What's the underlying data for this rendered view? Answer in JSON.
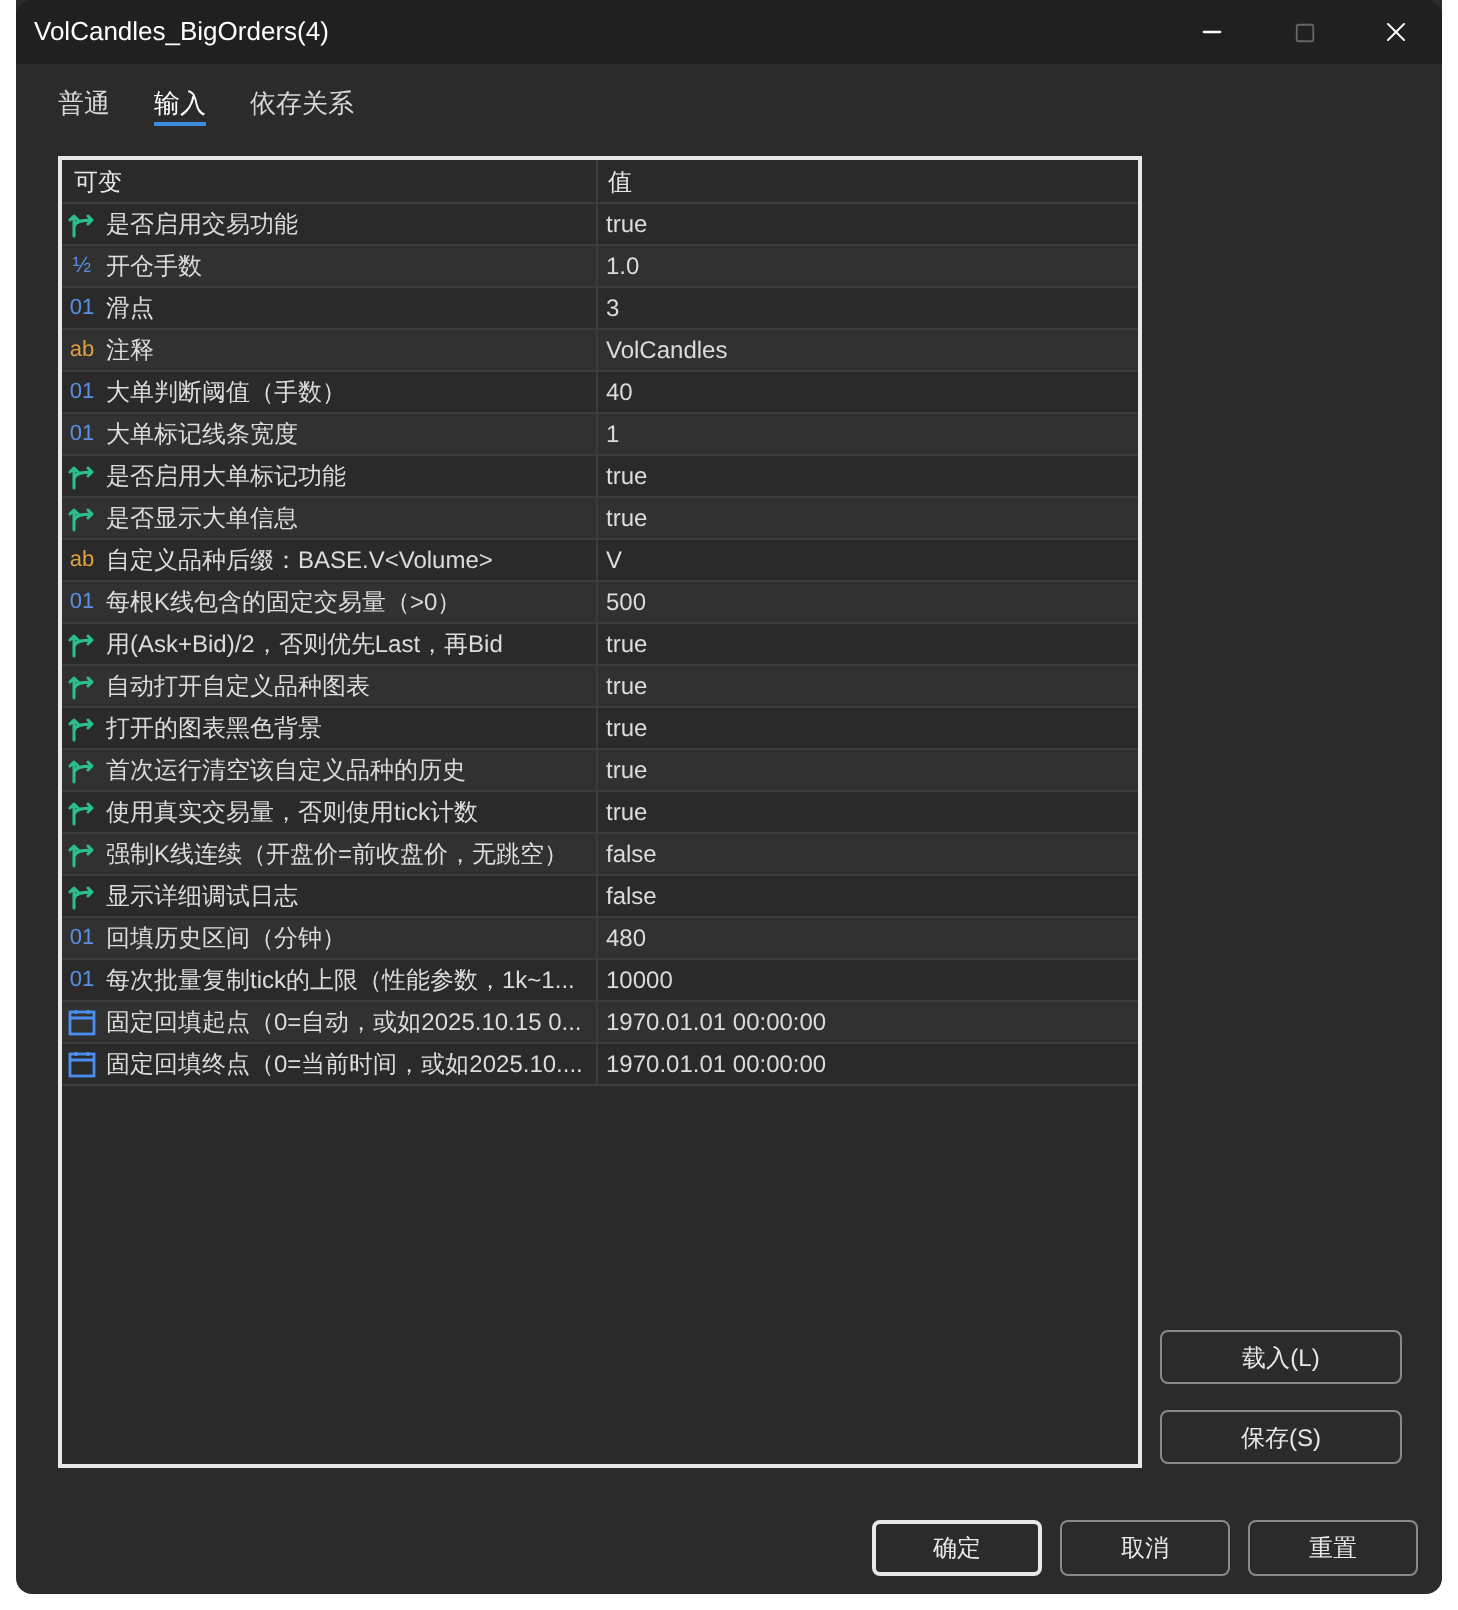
{
  "window": {
    "title": "VolCandles_BigOrders(4)",
    "maximize_disabled": true
  },
  "tabs": [
    {
      "label": "普通",
      "selected": false
    },
    {
      "label": "输入",
      "selected": true
    },
    {
      "label": "依存关系",
      "selected": false
    }
  ],
  "table": {
    "columns": [
      "可变",
      "值"
    ],
    "rows": [
      {
        "kind": "bool",
        "name": "是否启用交易功能",
        "value": "true"
      },
      {
        "kind": "double",
        "icon": "½",
        "name": "开仓手数",
        "value": "1.0"
      },
      {
        "kind": "int",
        "icon": "01",
        "name": "滑点",
        "value": "3"
      },
      {
        "kind": "string",
        "icon": "ab",
        "name": "注释",
        "value": "VolCandles"
      },
      {
        "kind": "int",
        "icon": "01",
        "name": "大单判断阈值（手数）",
        "value": "40"
      },
      {
        "kind": "int",
        "icon": "01",
        "name": "大单标记线条宽度",
        "value": "1"
      },
      {
        "kind": "bool",
        "name": "是否启用大单标记功能",
        "value": "true"
      },
      {
        "kind": "bool",
        "name": "是否显示大单信息",
        "value": "true"
      },
      {
        "kind": "string",
        "icon": "ab",
        "name": "自定义品种后缀：BASE.V<Volume>",
        "value": "V"
      },
      {
        "kind": "int",
        "icon": "01",
        "name": "每根K线包含的固定交易量（>0）",
        "value": "500"
      },
      {
        "kind": "bool",
        "name": "用(Ask+Bid)/2，否则优先Last，再Bid",
        "value": "true"
      },
      {
        "kind": "bool",
        "name": "自动打开自定义品种图表",
        "value": "true"
      },
      {
        "kind": "bool",
        "name": "打开的图表黑色背景",
        "value": "true"
      },
      {
        "kind": "bool",
        "name": "首次运行清空该自定义品种的历史",
        "value": "true"
      },
      {
        "kind": "bool",
        "name": "使用真实交易量，否则使用tick计数",
        "value": "true"
      },
      {
        "kind": "bool",
        "name": "强制K线连续（开盘价=前收盘价，无跳空）",
        "value": "false"
      },
      {
        "kind": "bool",
        "name": "显示详细调试日志",
        "value": "false"
      },
      {
        "kind": "int",
        "icon": "01",
        "name": "回填历史区间（分钟）",
        "value": "480"
      },
      {
        "kind": "int",
        "icon": "01",
        "name": "每次批量复制tick的上限（性能参数，1k~1...",
        "value": "10000"
      },
      {
        "kind": "datetime",
        "name": "固定回填起点（0=自动，或如2025.10.15 0...",
        "value": "1970.01.01 00:00:00"
      },
      {
        "kind": "datetime",
        "name": "固定回填终点（0=当前时间，或如2025.10....",
        "value": "1970.01.01 00:00:00"
      }
    ]
  },
  "side_buttons": [
    "载入(L)",
    "保存(S)"
  ],
  "footer_buttons": [
    {
      "label": "确定",
      "default": true
    },
    {
      "label": "取消",
      "default": false
    },
    {
      "label": "重置",
      "default": false
    }
  ]
}
